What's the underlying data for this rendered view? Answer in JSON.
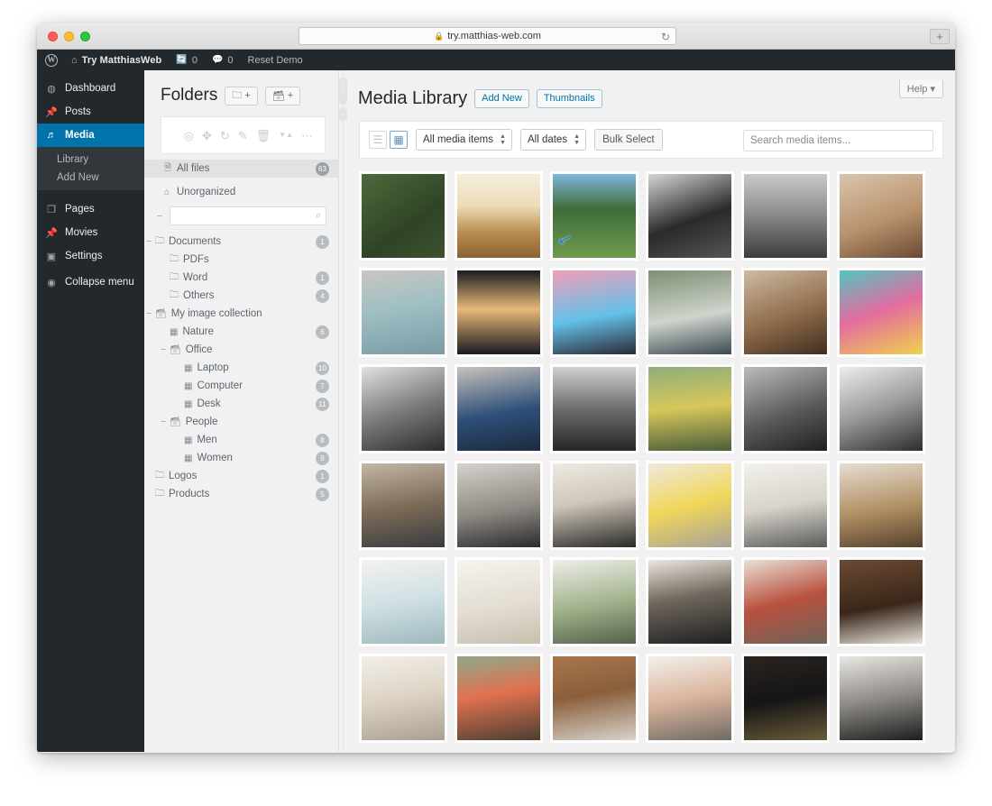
{
  "browser": {
    "url": "try.matthias-web.com",
    "lock_icon": "lock-icon",
    "reload_icon": "reload-icon",
    "newtab_label": "+"
  },
  "adminbar": {
    "wp_logo": "W",
    "home_icon": "home-icon",
    "site_name": "Try MatthiasWeb",
    "updates_icon": "updates-icon",
    "updates_count": "0",
    "comments_icon": "comments-icon",
    "comments_count": "0",
    "reset_demo": "Reset Demo"
  },
  "sidebar": {
    "items": [
      {
        "label": "Dashboard",
        "icon": "dashboard-icon",
        "glyph": "◉",
        "current": false
      },
      {
        "label": "Posts",
        "icon": "pin-icon",
        "glyph": "✎",
        "current": false
      },
      {
        "label": "Media",
        "icon": "media-icon",
        "glyph": "♫",
        "current": true
      }
    ],
    "submenu": [
      {
        "label": "Library"
      },
      {
        "label": "Add New"
      }
    ],
    "items2": [
      {
        "label": "Pages",
        "icon": "pages-icon",
        "glyph": "❐"
      },
      {
        "label": "Movies",
        "icon": "movies-icon",
        "glyph": "✎"
      },
      {
        "label": "Settings",
        "icon": "settings-icon",
        "glyph": "▣"
      }
    ],
    "collapse": {
      "label": "Collapse menu",
      "icon": "collapse-icon",
      "glyph": "◀"
    }
  },
  "folders": {
    "title": "Folders",
    "new_folder_btn": {
      "icon": "new-folder-icon",
      "glyph": "▭",
      "plus": "+"
    },
    "new_collection_btn": {
      "icon": "new-collection-icon",
      "glyph": "▤",
      "plus": "+"
    },
    "toolbar_icons": [
      {
        "name": "settings-icon",
        "glyph": "◎"
      },
      {
        "name": "move-icon",
        "glyph": "✥"
      },
      {
        "name": "refresh-icon",
        "glyph": "↻"
      },
      {
        "name": "edit-icon",
        "glyph": "✎"
      },
      {
        "name": "trash-icon",
        "glyph": "🗑"
      },
      {
        "name": "sort-icon",
        "glyph": "▼▲"
      },
      {
        "name": "more-icon",
        "glyph": "⋯"
      }
    ],
    "all_files": {
      "label": "All files",
      "icon": "file-icon",
      "glyph": "🗎",
      "count": "63"
    },
    "unorganized": {
      "label": "Unorganized",
      "icon": "home-icon",
      "glyph": "⌂",
      "count": ""
    },
    "search_placeholder": "",
    "search_icon": "search-icon",
    "tree": [
      {
        "label": "Documents",
        "icon": "folder-icon",
        "glyph": "▭",
        "count": "1",
        "depth": 0,
        "toggle": "−"
      },
      {
        "label": "PDFs",
        "icon": "folder-icon",
        "glyph": "▭",
        "count": "",
        "depth": 1,
        "toggle": ""
      },
      {
        "label": "Word",
        "icon": "folder-icon",
        "glyph": "▭",
        "count": "1",
        "depth": 1,
        "toggle": ""
      },
      {
        "label": "Others",
        "icon": "folder-icon",
        "glyph": "▭",
        "count": "4",
        "depth": 1,
        "toggle": ""
      },
      {
        "label": "My image collection",
        "icon": "collection-icon",
        "glyph": "▤",
        "count": "",
        "depth": 0,
        "toggle": "−"
      },
      {
        "label": "Nature",
        "icon": "gallery-icon",
        "glyph": "▦",
        "count": "6",
        "depth": 1,
        "toggle": ""
      },
      {
        "label": "Office",
        "icon": "collection-icon",
        "glyph": "▤",
        "count": "",
        "depth": 1,
        "toggle": "−"
      },
      {
        "label": "Laptop",
        "icon": "gallery-icon",
        "glyph": "▦",
        "count": "10",
        "depth": 2,
        "toggle": ""
      },
      {
        "label": "Computer",
        "icon": "gallery-icon",
        "glyph": "▦",
        "count": "7",
        "depth": 2,
        "toggle": ""
      },
      {
        "label": "Desk",
        "icon": "gallery-icon",
        "glyph": "▦",
        "count": "11",
        "depth": 2,
        "toggle": ""
      },
      {
        "label": "People",
        "icon": "collection-icon",
        "glyph": "▤",
        "count": "",
        "depth": 1,
        "toggle": "−"
      },
      {
        "label": "Men",
        "icon": "gallery-icon",
        "glyph": "▦",
        "count": "8",
        "depth": 2,
        "toggle": ""
      },
      {
        "label": "Women",
        "icon": "gallery-icon",
        "glyph": "▦",
        "count": "9",
        "depth": 2,
        "toggle": ""
      },
      {
        "label": "Logos",
        "icon": "folder-icon",
        "glyph": "▭",
        "count": "1",
        "depth": 0,
        "toggle": ""
      },
      {
        "label": "Products",
        "icon": "folder-icon",
        "glyph": "▭",
        "count": "5",
        "depth": 0,
        "toggle": ""
      }
    ]
  },
  "main": {
    "help_button": "Help",
    "help_caret": "▾",
    "page_title": "Media Library",
    "add_new_btn": "Add New",
    "thumbnails_btn": "Thumbnails",
    "toolbar": {
      "list_view_icon": "list-view-icon",
      "grid_view_icon": "grid-view-icon",
      "media_filter": "All media items",
      "date_filter": "All dates",
      "bulk_select": "Bulk Select",
      "search_placeholder": "Search media items..."
    },
    "cursor_icon": "cursor-arrow-icon",
    "grid_items": [
      {
        "alt": "green-field-rows",
        "css": "linear-gradient(145deg,#4e6a3c,#2f4425 60%,#3c5230)"
      },
      {
        "alt": "golden-dry-grass-sunset",
        "css": "linear-gradient(180deg,#f4efdd 0%,#ecdcb6 38%,#b98c4f 70%,#8a6234 100%)"
      },
      {
        "alt": "grass-blades-blue-sky",
        "css": "linear-gradient(180deg,#7fb6dc 0%,#3f6c3a 42%,#6d9c4e 100%)"
      },
      {
        "alt": "bw-portrait-hat-man",
        "css": "linear-gradient(160deg,#d6d6d6,#2a2a2a 55%,#555)"
      },
      {
        "alt": "bw-rugby-players-field",
        "css": "linear-gradient(180deg,#c9c9c9,#8f8f8f 45%,#3c3c3c)"
      },
      {
        "alt": "two-women-hats-portrait",
        "css": "linear-gradient(160deg,#d9c5ad,#b8926c 55%,#6b4a33)"
      },
      {
        "alt": "woman-blue-dress-arms-open",
        "css": "linear-gradient(170deg,#c9c6c0 0%,#9fbfc4 45%,#7b9aa4 100%)"
      },
      {
        "alt": "two-women-silhouette-sunset",
        "css": "linear-gradient(180deg,#1b1b22 0%,#e8b878 46%,#1a1a20 100%)"
      },
      {
        "alt": "three-women-pink-cloth-sky",
        "css": "linear-gradient(170deg,#ef9fb9 0%,#64c0e8 55%,#2a2a35 100%)"
      },
      {
        "alt": "woman-white-top-raised-arms",
        "css": "linear-gradient(170deg,#7d8f73,#cfd4cc 55%,#3c4a52)"
      },
      {
        "alt": "braided-hair-back-portrait",
        "css": "linear-gradient(160deg,#cdbba4,#8f6b4a 55%,#3f2e22)"
      },
      {
        "alt": "group-women-colorful-street",
        "css": "linear-gradient(160deg,#52c6c0,#e36ba0 48%,#f0d24d)"
      },
      {
        "alt": "bw-man-sign-street",
        "css": "linear-gradient(160deg,#e2e2e2,#7d7d7d 50%,#2b2b2b)"
      },
      {
        "alt": "two-men-suits-street",
        "css": "linear-gradient(170deg,#c7c3bb,#2f4f7a 55%,#1c2a3e)"
      },
      {
        "alt": "bw-rugby-scrum",
        "css": "linear-gradient(180deg,#cfcfcf,#6d6d6d 50%,#262626)"
      },
      {
        "alt": "people-field-yellow-jackets",
        "css": "linear-gradient(175deg,#8fae7c,#d7c75a 48%,#4b5f3a)"
      },
      {
        "alt": "bw-woman-hand-face",
        "css": "linear-gradient(160deg,#bcbcbc,#5b5b5b 55%,#1f1f1f)"
      },
      {
        "alt": "bw-man-framed-portrait",
        "css": "linear-gradient(160deg,#ededed,#9a9a9a 50%,#2d2d2d)"
      },
      {
        "alt": "man-bike-urban",
        "css": "linear-gradient(170deg,#c3b7a6,#7e6d58 50%,#3b3b3f)"
      },
      {
        "alt": "woman-dark-top-wall",
        "css": "linear-gradient(170deg,#d7d2cb,#8f8a84 55%,#2b2b2e)"
      },
      {
        "alt": "black-box-notebook-desk",
        "css": "linear-gradient(170deg,#efeae2,#cfc6b8 45%,#2a2a2a)"
      },
      {
        "alt": "camera-yellow-paper-desk",
        "css": "linear-gradient(165deg,#efe9de,#f0d75a 50%,#a8a198)"
      },
      {
        "alt": "glasses-keyboard-white-desk",
        "css": "linear-gradient(170deg,#f3f1ec,#d8d4cc 50%,#5b5b58)"
      },
      {
        "alt": "wooden-toy-camera-desk",
        "css": "linear-gradient(170deg,#e6ded2,#b08f63 55%,#55412c)"
      },
      {
        "alt": "keyboard-glasses-notebook-flatlay",
        "css": "linear-gradient(170deg,#f4f2ee,#cfe0e4 50%,#9fb8bd)"
      },
      {
        "alt": "coffee-cup-notebook-white",
        "css": "linear-gradient(170deg,#f6f4ef,#e3ddd2 55%,#c8bfae)"
      },
      {
        "alt": "plant-cup-desk-window",
        "css": "linear-gradient(170deg,#efeee9,#9eb089 55%,#55604a)"
      },
      {
        "alt": "monitor-dark-desk-wood",
        "css": "linear-gradient(170deg,#ece7df,#6f675d 45%,#1f1f1f)"
      },
      {
        "alt": "books-notebook-red-desk",
        "css": "linear-gradient(165deg,#e8e2d6,#b9513f 50%,#6d6458)"
      },
      {
        "alt": "dark-wood-desk-monitor",
        "css": "linear-gradient(170deg,#6b4a33,#3a2619 55%,#e9e4dc)"
      },
      {
        "alt": "desk-flatlay-phone-books",
        "css": "linear-gradient(170deg,#f2efe9,#dcd2c2 50%,#a9a092)"
      },
      {
        "alt": "imac-deer-wallpaper-orange",
        "css": "linear-gradient(170deg,#8fa98b,#e0714f 45%,#4b3f33)"
      },
      {
        "alt": "imac-wood-wall-desk",
        "css": "linear-gradient(170deg,#a9764c,#8a5f3c 45%,#d8d3cb)"
      },
      {
        "alt": "white-desk-imac-person",
        "css": "linear-gradient(170deg,#f3f0ea,#d9b49c 50%,#6f6a63)"
      },
      {
        "alt": "dark-studio-multi-monitor",
        "css": "linear-gradient(170deg,#2a2420,#151515 50%,#6b5a3a)"
      },
      {
        "alt": "flip-clock-1559-desk",
        "css": "linear-gradient(170deg,#e9e7e2,#8e8b86 50%,#1e1e1e)"
      }
    ]
  }
}
